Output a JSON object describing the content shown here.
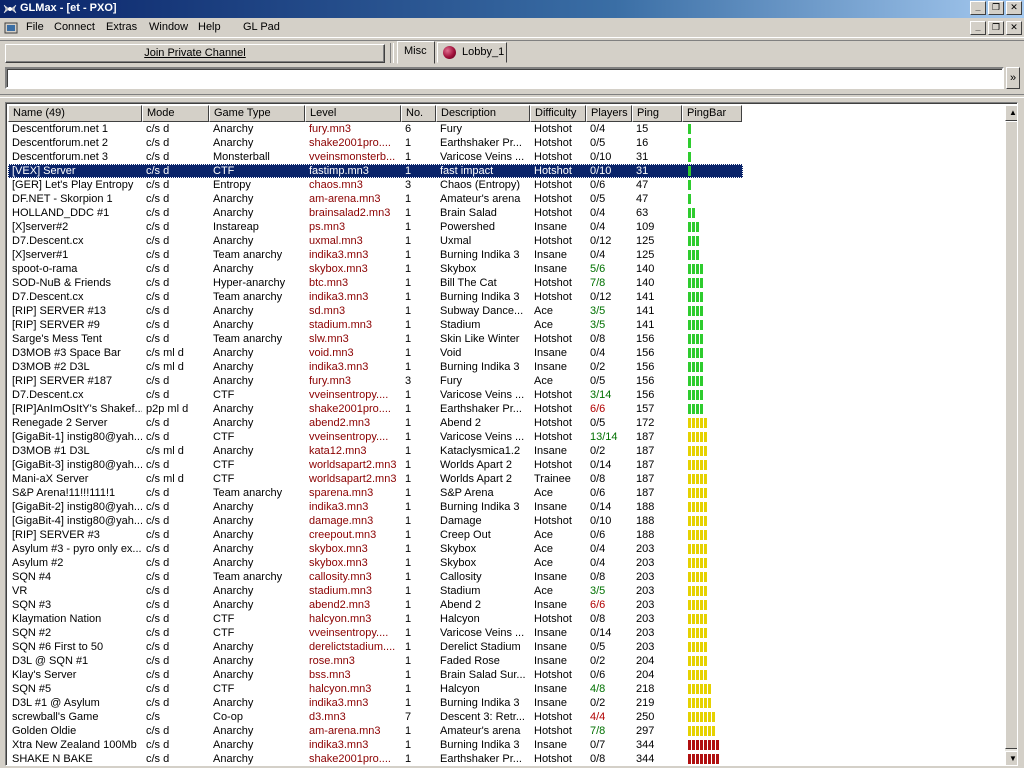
{
  "window": {
    "title": "GLMax - [et - PXO]"
  },
  "menu": [
    "File",
    "Connect",
    "Extras",
    "Window",
    "Help",
    "GL Pad"
  ],
  "toolbar": {
    "join_label": "Join Private Channel"
  },
  "tabs": [
    {
      "label": "Misc",
      "active": true
    },
    {
      "label": "Lobby_1",
      "active": false
    }
  ],
  "input": {
    "value": "",
    "send_glyph": "»"
  },
  "colors": {
    "titlebar_start": "#0a246a",
    "selection": "#0a246a",
    "level_text": "#8b0000",
    "pingbar_green": "#2ecc2e",
    "pingbar_yellow": "#e6d200",
    "pingbar_red": "#b01010"
  },
  "list": {
    "columns": [
      "Name (49)",
      "Mode",
      "Game Type",
      "Level",
      "No.",
      "Description",
      "Difficulty",
      "Players",
      "Ping",
      "PingBar"
    ],
    "selected_index": 3,
    "rows": [
      {
        "name": "Descentforum.net 1",
        "mode": "c/s d",
        "type": "Anarchy",
        "level": "fury.mn3",
        "no": "6",
        "desc": "Fury",
        "diff": "Hotshot",
        "players": "0/4",
        "pc": "",
        "ping": "15",
        "bars": 1,
        "bc": "green"
      },
      {
        "name": "Descentforum.net 2",
        "mode": "c/s d",
        "type": "Anarchy",
        "level": "shake2001pro....",
        "no": "1",
        "desc": "Earthshaker Pr...",
        "diff": "Hotshot",
        "players": "0/5",
        "pc": "",
        "ping": "16",
        "bars": 1,
        "bc": "green"
      },
      {
        "name": "Descentforum.net 3",
        "mode": "c/s d",
        "type": "Monsterball",
        "level": "vveinsmonsterb...",
        "no": "1",
        "desc": "Varicose Veins ...",
        "diff": "Hotshot",
        "players": "0/10",
        "pc": "",
        "ping": "31",
        "bars": 1,
        "bc": "green"
      },
      {
        "name": "[VEX] Server",
        "mode": "c/s d",
        "type": "CTF",
        "level": "fastimp.mn3",
        "no": "1",
        "desc": "fast impact",
        "diff": "Hotshot",
        "players": "0/10",
        "pc": "",
        "ping": "31",
        "bars": 1,
        "bc": "green"
      },
      {
        "name": "[GER] Let's Play  Entropy",
        "mode": "c/s d",
        "type": "Entropy",
        "level": "chaos.mn3",
        "no": "3",
        "desc": "Chaos (Entropy)",
        "diff": "Hotshot",
        "players": "0/6",
        "pc": "",
        "ping": "47",
        "bars": 1,
        "bc": "green"
      },
      {
        "name": "DF.NET - Skorpion 1",
        "mode": "c/s d",
        "type": "Anarchy",
        "level": "am-arena.mn3",
        "no": "1",
        "desc": "Amateur's arena",
        "diff": "Hotshot",
        "players": "0/5",
        "pc": "",
        "ping": "47",
        "bars": 1,
        "bc": "green"
      },
      {
        "name": "HOLLAND_DDC #1",
        "mode": "c/s d",
        "type": "Anarchy",
        "level": "brainsalad2.mn3",
        "no": "1",
        "desc": "Brain Salad",
        "diff": "Hotshot",
        "players": "0/4",
        "pc": "",
        "ping": "63",
        "bars": 2,
        "bc": "green"
      },
      {
        "name": "[X]server#2",
        "mode": "c/s d",
        "type": "Instareap",
        "level": "ps.mn3",
        "no": "1",
        "desc": "Powershed",
        "diff": "Insane",
        "players": "0/4",
        "pc": "",
        "ping": "109",
        "bars": 3,
        "bc": "green"
      },
      {
        "name": "D7.Descent.cx",
        "mode": "c/s d",
        "type": "Anarchy",
        "level": "uxmal.mn3",
        "no": "1",
        "desc": "Uxmal",
        "diff": "Hotshot",
        "players": "0/12",
        "pc": "",
        "ping": "125",
        "bars": 3,
        "bc": "green"
      },
      {
        "name": "[X]server#1",
        "mode": "c/s d",
        "type": "Team anarchy",
        "level": "indika3.mn3",
        "no": "1",
        "desc": "Burning Indika 3",
        "diff": "Insane",
        "players": "0/4",
        "pc": "",
        "ping": "125",
        "bars": 3,
        "bc": "green"
      },
      {
        "name": "spoot-o-rama",
        "mode": "c/s d",
        "type": "Anarchy",
        "level": "skybox.mn3",
        "no": "1",
        "desc": "Skybox",
        "diff": "Insane",
        "players": "5/6",
        "pc": "green",
        "ping": "140",
        "bars": 4,
        "bc": "green"
      },
      {
        "name": "SOD-NuB & Friends",
        "mode": "c/s d",
        "type": "Hyper-anarchy",
        "level": "btc.mn3",
        "no": "1",
        "desc": "Bill The Cat",
        "diff": "Hotshot",
        "players": "7/8",
        "pc": "green",
        "ping": "140",
        "bars": 4,
        "bc": "green"
      },
      {
        "name": "D7.Descent.cx",
        "mode": "c/s d",
        "type": "Team anarchy",
        "level": "indika3.mn3",
        "no": "1",
        "desc": "Burning Indika 3",
        "diff": "Hotshot",
        "players": "0/12",
        "pc": "",
        "ping": "141",
        "bars": 4,
        "bc": "green"
      },
      {
        "name": "[RIP] SERVER #13",
        "mode": "c/s d",
        "type": "Anarchy",
        "level": "sd.mn3",
        "no": "1",
        "desc": "Subway Dance...",
        "diff": "Ace",
        "players": "3/5",
        "pc": "green",
        "ping": "141",
        "bars": 4,
        "bc": "green"
      },
      {
        "name": "[RIP] SERVER #9",
        "mode": "c/s d",
        "type": "Anarchy",
        "level": "stadium.mn3",
        "no": "1",
        "desc": "Stadium",
        "diff": "Ace",
        "players": "3/5",
        "pc": "green",
        "ping": "141",
        "bars": 4,
        "bc": "green"
      },
      {
        "name": "Sarge's Mess Tent",
        "mode": "c/s d",
        "type": "Team anarchy",
        "level": "slw.mn3",
        "no": "1",
        "desc": "Skin Like Winter",
        "diff": "Hotshot",
        "players": "0/8",
        "pc": "",
        "ping": "156",
        "bars": 4,
        "bc": "green"
      },
      {
        "name": "D3MOB #3 Space Bar",
        "mode": "c/s ml d",
        "type": "Anarchy",
        "level": "void.mn3",
        "no": "1",
        "desc": "Void",
        "diff": "Insane",
        "players": "0/4",
        "pc": "",
        "ping": "156",
        "bars": 4,
        "bc": "green"
      },
      {
        "name": "D3MOB #2 D3L",
        "mode": "c/s ml d",
        "type": "Anarchy",
        "level": "indika3.mn3",
        "no": "1",
        "desc": "Burning Indika 3",
        "diff": "Insane",
        "players": "0/2",
        "pc": "",
        "ping": "156",
        "bars": 4,
        "bc": "green"
      },
      {
        "name": "[RIP] SERVER #187",
        "mode": "c/s d",
        "type": "Anarchy",
        "level": "fury.mn3",
        "no": "3",
        "desc": "Fury",
        "diff": "Ace",
        "players": "0/5",
        "pc": "",
        "ping": "156",
        "bars": 4,
        "bc": "green"
      },
      {
        "name": "D7.Descent.cx",
        "mode": "c/s d",
        "type": "CTF",
        "level": "vveinsentropy....",
        "no": "1",
        "desc": "Varicose Veins ...",
        "diff": "Hotshot",
        "players": "3/14",
        "pc": "green",
        "ping": "156",
        "bars": 4,
        "bc": "green"
      },
      {
        "name": "[RIP]AnImOsItY's Shakef...",
        "mode": "p2p ml d",
        "type": "Anarchy",
        "level": "shake2001pro....",
        "no": "1",
        "desc": "Earthshaker Pr...",
        "diff": "Hotshot",
        "players": "6/6",
        "pc": "red",
        "ping": "157",
        "bars": 4,
        "bc": "green"
      },
      {
        "name": "Renegade 2 Server",
        "mode": "c/s d",
        "type": "Anarchy",
        "level": "abend2.mn3",
        "no": "1",
        "desc": "Abend 2",
        "diff": "Hotshot",
        "players": "0/5",
        "pc": "",
        "ping": "172",
        "bars": 5,
        "bc": "yellow"
      },
      {
        "name": "[GigaBit-1] instig80@yah...",
        "mode": "c/s d",
        "type": "CTF",
        "level": "vveinsentropy....",
        "no": "1",
        "desc": "Varicose Veins ...",
        "diff": "Hotshot",
        "players": "13/14",
        "pc": "green",
        "ping": "187",
        "bars": 5,
        "bc": "yellow"
      },
      {
        "name": "D3MOB #1 D3L",
        "mode": "c/s ml d",
        "type": "Anarchy",
        "level": "kata12.mn3",
        "no": "1",
        "desc": "Kataclysmica1.2",
        "diff": "Insane",
        "players": "0/2",
        "pc": "",
        "ping": "187",
        "bars": 5,
        "bc": "yellow"
      },
      {
        "name": "[GigaBit-3] instig80@yah...",
        "mode": "c/s d",
        "type": "CTF",
        "level": "worldsapart2.mn3",
        "no": "1",
        "desc": "Worlds Apart 2",
        "diff": "Hotshot",
        "players": "0/14",
        "pc": "",
        "ping": "187",
        "bars": 5,
        "bc": "yellow"
      },
      {
        "name": "Mani-aX Server",
        "mode": "c/s ml d",
        "type": "CTF",
        "level": "worldsapart2.mn3",
        "no": "1",
        "desc": "Worlds Apart 2",
        "diff": "Trainee",
        "players": "0/8",
        "pc": "",
        "ping": "187",
        "bars": 5,
        "bc": "yellow"
      },
      {
        "name": "S&P Arena!11!!!111!1",
        "mode": "c/s d",
        "type": "Team anarchy",
        "level": "sparena.mn3",
        "no": "1",
        "desc": "S&P Arena",
        "diff": "Ace",
        "players": "0/6",
        "pc": "",
        "ping": "187",
        "bars": 5,
        "bc": "yellow"
      },
      {
        "name": "[GigaBit-2] instig80@yah...",
        "mode": "c/s d",
        "type": "Anarchy",
        "level": "indika3.mn3",
        "no": "1",
        "desc": "Burning Indika 3",
        "diff": "Insane",
        "players": "0/14",
        "pc": "",
        "ping": "188",
        "bars": 5,
        "bc": "yellow"
      },
      {
        "name": "[GigaBit-4] instig80@yah...",
        "mode": "c/s d",
        "type": "Anarchy",
        "level": "damage.mn3",
        "no": "1",
        "desc": "Damage",
        "diff": "Hotshot",
        "players": "0/10",
        "pc": "",
        "ping": "188",
        "bars": 5,
        "bc": "yellow"
      },
      {
        "name": "[RIP] SERVER #3",
        "mode": "c/s d",
        "type": "Anarchy",
        "level": "creepout.mn3",
        "no": "1",
        "desc": "Creep Out",
        "diff": "Ace",
        "players": "0/6",
        "pc": "",
        "ping": "188",
        "bars": 5,
        "bc": "yellow"
      },
      {
        "name": "Asylum #3 - pyro only ex...",
        "mode": "c/s d",
        "type": "Anarchy",
        "level": "skybox.mn3",
        "no": "1",
        "desc": "Skybox",
        "diff": "Ace",
        "players": "0/4",
        "pc": "",
        "ping": "203",
        "bars": 5,
        "bc": "yellow"
      },
      {
        "name": "Asylum #2",
        "mode": "c/s d",
        "type": "Anarchy",
        "level": "skybox.mn3",
        "no": "1",
        "desc": "Skybox",
        "diff": "Ace",
        "players": "0/4",
        "pc": "",
        "ping": "203",
        "bars": 5,
        "bc": "yellow"
      },
      {
        "name": "SQN #4",
        "mode": "c/s d",
        "type": "Team anarchy",
        "level": "callosity.mn3",
        "no": "1",
        "desc": "Callosity",
        "diff": "Insane",
        "players": "0/8",
        "pc": "",
        "ping": "203",
        "bars": 5,
        "bc": "yellow"
      },
      {
        "name": "VR",
        "mode": "c/s d",
        "type": "Anarchy",
        "level": "stadium.mn3",
        "no": "1",
        "desc": "Stadium",
        "diff": "Ace",
        "players": "3/5",
        "pc": "green",
        "ping": "203",
        "bars": 5,
        "bc": "yellow"
      },
      {
        "name": "SQN #3",
        "mode": "c/s d",
        "type": "Anarchy",
        "level": "abend2.mn3",
        "no": "1",
        "desc": "Abend 2",
        "diff": "Insane",
        "players": "6/6",
        "pc": "red",
        "ping": "203",
        "bars": 5,
        "bc": "yellow"
      },
      {
        "name": "Klaymation Nation",
        "mode": "c/s d",
        "type": "CTF",
        "level": "halcyon.mn3",
        "no": "1",
        "desc": "Halcyon",
        "diff": "Hotshot",
        "players": "0/8",
        "pc": "",
        "ping": "203",
        "bars": 5,
        "bc": "yellow"
      },
      {
        "name": "SQN #2",
        "mode": "c/s d",
        "type": "CTF",
        "level": "vveinsentropy....",
        "no": "1",
        "desc": "Varicose Veins ...",
        "diff": "Insane",
        "players": "0/14",
        "pc": "",
        "ping": "203",
        "bars": 5,
        "bc": "yellow"
      },
      {
        "name": "SQN #6  First to 50",
        "mode": "c/s d",
        "type": "Anarchy",
        "level": "derelictstadium....",
        "no": "1",
        "desc": "Derelict Stadium",
        "diff": "Insane",
        "players": "0/5",
        "pc": "",
        "ping": "203",
        "bars": 5,
        "bc": "yellow"
      },
      {
        "name": "D3L @ SQN #1",
        "mode": "c/s d",
        "type": "Anarchy",
        "level": "rose.mn3",
        "no": "1",
        "desc": "Faded Rose",
        "diff": "Insane",
        "players": "0/2",
        "pc": "",
        "ping": "204",
        "bars": 5,
        "bc": "yellow"
      },
      {
        "name": "Klay's Server",
        "mode": "c/s d",
        "type": "Anarchy",
        "level": "bss.mn3",
        "no": "1",
        "desc": "Brain Salad Sur...",
        "diff": "Hotshot",
        "players": "0/6",
        "pc": "",
        "ping": "204",
        "bars": 5,
        "bc": "yellow"
      },
      {
        "name": "SQN #5",
        "mode": "c/s d",
        "type": "CTF",
        "level": "halcyon.mn3",
        "no": "1",
        "desc": "Halcyon",
        "diff": "Insane",
        "players": "4/8",
        "pc": "green",
        "ping": "218",
        "bars": 6,
        "bc": "yellow"
      },
      {
        "name": "D3L #1 @ Asylum",
        "mode": "c/s d",
        "type": "Anarchy",
        "level": "indika3.mn3",
        "no": "1",
        "desc": "Burning Indika 3",
        "diff": "Insane",
        "players": "0/2",
        "pc": "",
        "ping": "219",
        "bars": 6,
        "bc": "yellow"
      },
      {
        "name": "screwball's Game",
        "mode": "c/s",
        "type": "Co-op",
        "level": "d3.mn3",
        "no": "7",
        "desc": "Descent 3: Retr...",
        "diff": "Hotshot",
        "players": "4/4",
        "pc": "red",
        "ping": "250",
        "bars": 7,
        "bc": "yellow"
      },
      {
        "name": "Golden Oldie",
        "mode": "c/s d",
        "type": "Anarchy",
        "level": "am-arena.mn3",
        "no": "1",
        "desc": "Amateur's arena",
        "diff": "Hotshot",
        "players": "7/8",
        "pc": "green",
        "ping": "297",
        "bars": 7,
        "bc": "yellow"
      },
      {
        "name": "Xtra New Zealand 100Mb",
        "mode": "c/s d",
        "type": "Anarchy",
        "level": "indika3.mn3",
        "no": "1",
        "desc": "Burning Indika 3",
        "diff": "Insane",
        "players": "0/7",
        "pc": "",
        "ping": "344",
        "bars": 8,
        "bc": "red"
      },
      {
        "name": "SHAKE N BAKE",
        "mode": "c/s d",
        "type": "Anarchy",
        "level": "shake2001pro....",
        "no": "1",
        "desc": "Earthshaker Pr...",
        "diff": "Hotshot",
        "players": "0/8",
        "pc": "",
        "ping": "344",
        "bars": 8,
        "bc": "red"
      }
    ]
  }
}
